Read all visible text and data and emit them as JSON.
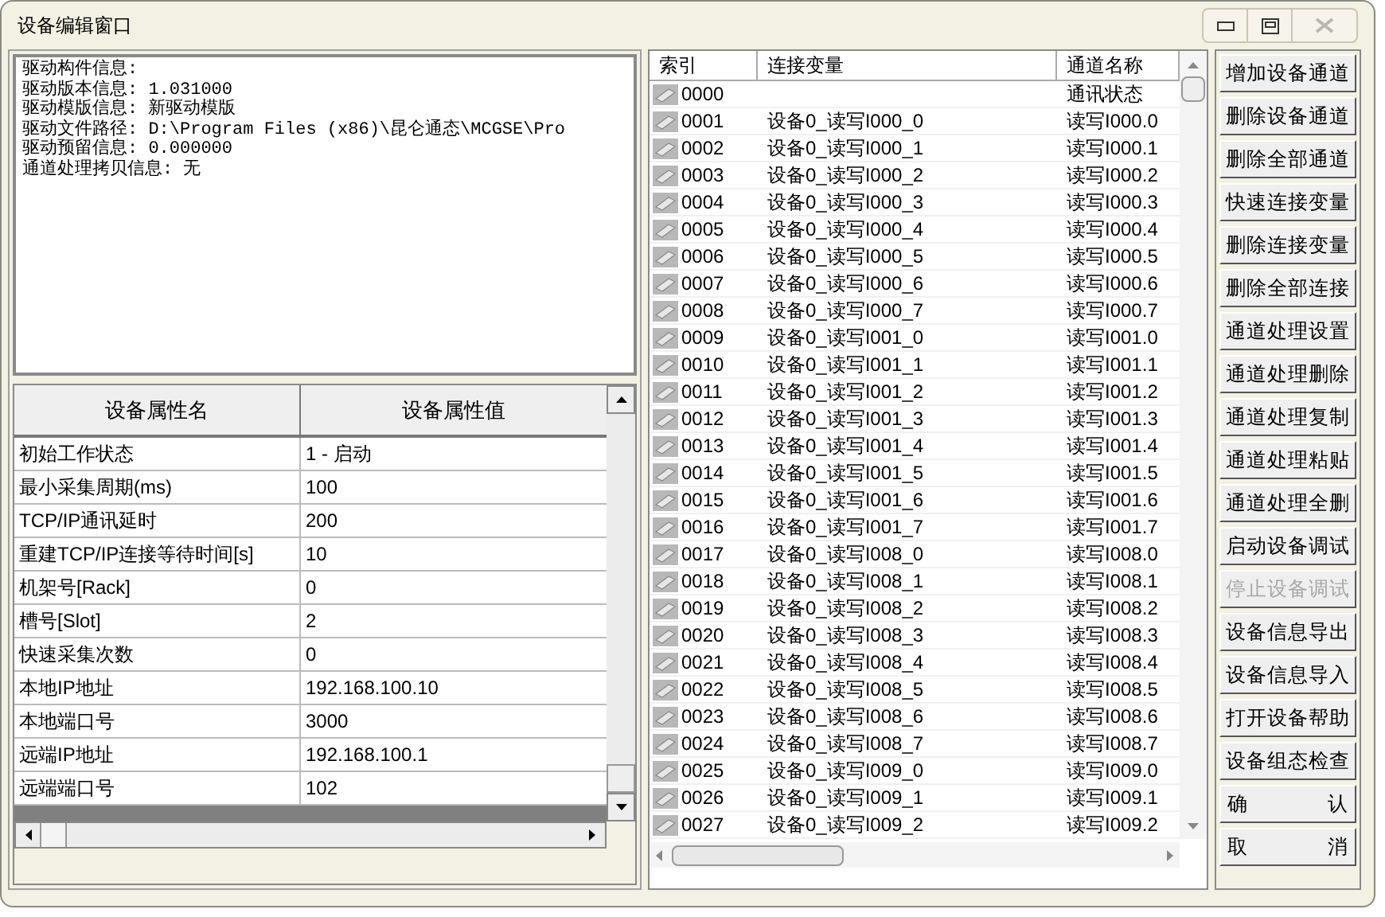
{
  "window": {
    "title": "设备编辑窗口",
    "close_disabled": true
  },
  "info_lines": [
    "驱动构件信息:",
    "驱动版本信息: 1.031000",
    "驱动模版信息: 新驱动模版",
    "驱动文件路径: D:\\Program Files (x86)\\昆仑通态\\MCGSE\\Pro",
    "驱动预留信息: 0.000000",
    "通道处理拷贝信息: 无"
  ],
  "properties": {
    "columns": [
      "设备属性名",
      "设备属性值"
    ],
    "rows": [
      {
        "name": "初始工作状态",
        "value": "1 - 启动"
      },
      {
        "name": "最小采集周期(ms)",
        "value": "100"
      },
      {
        "name": "TCP/IP通讯延时",
        "value": "200"
      },
      {
        "name": "重建TCP/IP连接等待时间[s]",
        "value": "10"
      },
      {
        "name": "机架号[Rack]",
        "value": "0"
      },
      {
        "name": "槽号[Slot]",
        "value": "2"
      },
      {
        "name": "快速采集次数",
        "value": "0"
      },
      {
        "name": "本地IP地址",
        "value": "192.168.100.10"
      },
      {
        "name": "本地端口号",
        "value": "3000"
      },
      {
        "name": "远端IP地址",
        "value": "192.168.100.1"
      },
      {
        "name": "远端端口号",
        "value": "102"
      }
    ]
  },
  "channels": {
    "columns": [
      "索引",
      "连接变量",
      "通道名称"
    ],
    "rows": [
      {
        "index": "0000",
        "channel": "通讯状态"
      },
      {
        "index": "0001",
        "variable": "设备0_读写I000_0",
        "channel": "读写I000.0"
      },
      {
        "index": "0002",
        "variable": "设备0_读写I000_1",
        "channel": "读写I000.1"
      },
      {
        "index": "0003",
        "variable": "设备0_读写I000_2",
        "channel": "读写I000.2"
      },
      {
        "index": "0004",
        "variable": "设备0_读写I000_3",
        "channel": "读写I000.3"
      },
      {
        "index": "0005",
        "variable": "设备0_读写I000_4",
        "channel": "读写I000.4"
      },
      {
        "index": "0006",
        "variable": "设备0_读写I000_5",
        "channel": "读写I000.5"
      },
      {
        "index": "0007",
        "variable": "设备0_读写I000_6",
        "channel": "读写I000.6"
      },
      {
        "index": "0008",
        "variable": "设备0_读写I000_7",
        "channel": "读写I000.7"
      },
      {
        "index": "0009",
        "variable": "设备0_读写I001_0",
        "channel": "读写I001.0"
      },
      {
        "index": "0010",
        "variable": "设备0_读写I001_1",
        "channel": "读写I001.1"
      },
      {
        "index": "0011",
        "variable": "设备0_读写I001_2",
        "channel": "读写I001.2"
      },
      {
        "index": "0012",
        "variable": "设备0_读写I001_3",
        "channel": "读写I001.3"
      },
      {
        "index": "0013",
        "variable": "设备0_读写I001_4",
        "channel": "读写I001.4"
      },
      {
        "index": "0014",
        "variable": "设备0_读写I001_5",
        "channel": "读写I001.5"
      },
      {
        "index": "0015",
        "variable": "设备0_读写I001_6",
        "channel": "读写I001.6"
      },
      {
        "index": "0016",
        "variable": "设备0_读写I001_7",
        "channel": "读写I001.7"
      },
      {
        "index": "0017",
        "variable": "设备0_读写I008_0",
        "channel": "读写I008.0"
      },
      {
        "index": "0018",
        "variable": "设备0_读写I008_1",
        "channel": "读写I008.1"
      },
      {
        "index": "0019",
        "variable": "设备0_读写I008_2",
        "channel": "读写I008.2"
      },
      {
        "index": "0020",
        "variable": "设备0_读写I008_3",
        "channel": "读写I008.3"
      },
      {
        "index": "0021",
        "variable": "设备0_读写I008_4",
        "channel": "读写I008.4"
      },
      {
        "index": "0022",
        "variable": "设备0_读写I008_5",
        "channel": "读写I008.5"
      },
      {
        "index": "0023",
        "variable": "设备0_读写I008_6",
        "channel": "读写I008.6"
      },
      {
        "index": "0024",
        "variable": "设备0_读写I008_7",
        "channel": "读写I008.7"
      },
      {
        "index": "0025",
        "variable": "设备0_读写I009_0",
        "channel": "读写I009.0"
      },
      {
        "index": "0026",
        "variable": "设备0_读写I009_1",
        "channel": "读写I009.1"
      },
      {
        "index": "0027",
        "variable": "设备0_读写I009_2",
        "channel": "读写I009.2"
      }
    ]
  },
  "buttons": [
    {
      "label": "增加设备通道",
      "disabled": false
    },
    {
      "label": "删除设备通道",
      "disabled": false
    },
    {
      "label": "删除全部通道",
      "disabled": false
    },
    {
      "label": "快速连接变量",
      "disabled": false
    },
    {
      "label": "删除连接变量",
      "disabled": false
    },
    {
      "label": "删除全部连接",
      "disabled": false
    },
    {
      "label": "通道处理设置",
      "disabled": false
    },
    {
      "label": "通道处理删除",
      "disabled": false
    },
    {
      "label": "通道处理复制",
      "disabled": false
    },
    {
      "label": "通道处理粘贴",
      "disabled": false
    },
    {
      "label": "通道处理全删",
      "disabled": false
    },
    {
      "label": "启动设备调试",
      "disabled": false
    },
    {
      "label": "停止设备调试",
      "disabled": true
    },
    {
      "label": "设备信息导出",
      "disabled": false
    },
    {
      "label": "设备信息导入",
      "disabled": false
    },
    {
      "label": "打开设备帮助",
      "disabled": false
    },
    {
      "label": "设备组态检查",
      "disabled": false
    },
    {
      "label": "确 认",
      "disabled": false
    },
    {
      "label": "取 消",
      "disabled": false
    }
  ]
}
